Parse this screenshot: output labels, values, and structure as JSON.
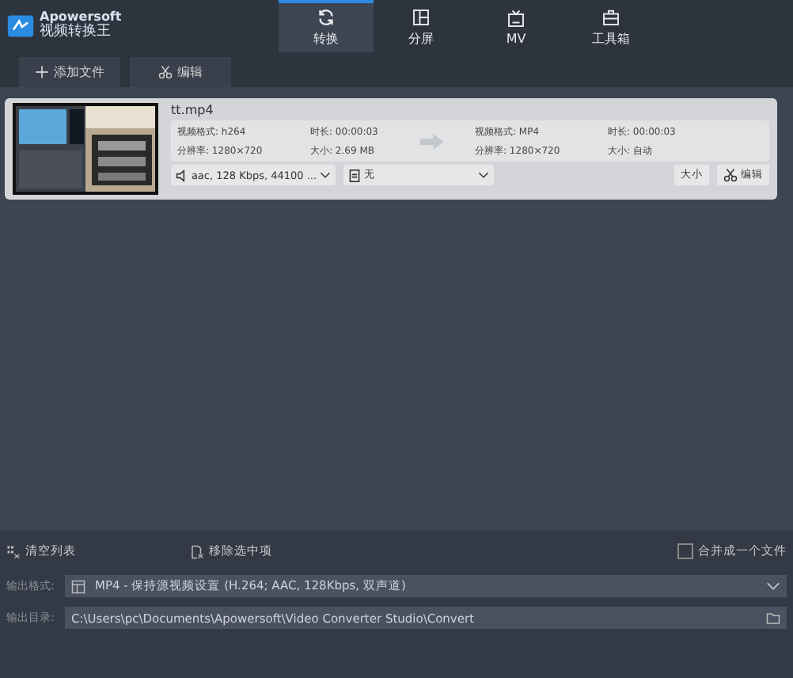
{
  "app": {
    "brand": "Apowersoft",
    "title": "视频转换王"
  },
  "tabs": [
    {
      "label": "转换",
      "selected": true
    },
    {
      "label": "分屏",
      "selected": false
    },
    {
      "label": "MV",
      "selected": false
    },
    {
      "label": "工具箱",
      "selected": false
    }
  ],
  "toolbar": [
    {
      "label": "添加文件"
    },
    {
      "label": "编辑"
    }
  ],
  "file": {
    "name": "tt.mp4",
    "source": [
      {
        "label": "视频格式:",
        "value": "h264"
      },
      {
        "label": "时长:",
        "value": "00:00:03"
      },
      {
        "label": "分辨率:",
        "value": "1280×720"
      },
      {
        "label": "大小:",
        "value": "2.69 MB"
      }
    ],
    "target": [
      {
        "label": "视频格式:",
        "value": "MP4"
      },
      {
        "label": "时长:",
        "value": "00:00:03"
      },
      {
        "label": "分辨率:",
        "value": "1280×720"
      },
      {
        "label": "大小:",
        "value": "自动"
      }
    ],
    "audio": "aac, 128 Kbps, 44100 ...",
    "subtitle": "无",
    "size_button": "大小",
    "edit_button": "编辑"
  },
  "actions": [
    {
      "label": "清空列表"
    },
    {
      "label": "移除选中项"
    }
  ],
  "merge": {
    "label": "合并成一个文件",
    "checked": false
  },
  "output_format": {
    "label": "输出格式:",
    "value": "MP4 - 保持源视频设置 (H.264; AAC, 128Kbps, 双声道)"
  },
  "output_dir": {
    "label": "输出目录:",
    "value": "C:\\Users\\pc\\Documents\\Apowersoft\\Video Converter Studio\\Convert"
  }
}
